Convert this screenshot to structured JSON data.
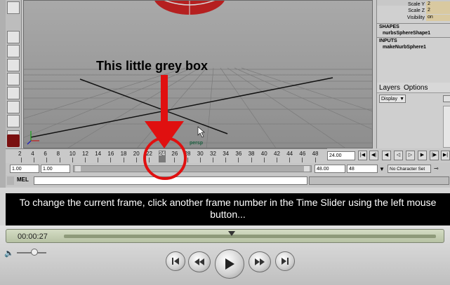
{
  "viewport": {
    "annotation": "This little grey box",
    "camera_label": "persp"
  },
  "attributes": {
    "rows": [
      {
        "label": "Scale Y",
        "value": "2"
      },
      {
        "label": "Scale Z",
        "value": "2"
      },
      {
        "label": "Visibility",
        "value": "on"
      }
    ],
    "shapes_header": "SHAPES",
    "shape_node": "nurbsSphereShape1",
    "inputs_header": "INPUTS",
    "input_node": "makeNurbSphere1"
  },
  "layers": {
    "menu_layers": "Layers",
    "menu_options": "Options",
    "display_select": "Display"
  },
  "time_slider": {
    "ticks": [
      "2",
      "4",
      "6",
      "8",
      "10",
      "12",
      "14",
      "16",
      "18",
      "20",
      "22",
      "24",
      "26",
      "28",
      "30",
      "32",
      "34",
      "36",
      "38",
      "40",
      "42",
      "44",
      "46",
      "48"
    ],
    "current_frame": "24",
    "current_time_field": "24.00"
  },
  "range": {
    "start_time": "1.00",
    "playback_start": "1.00",
    "playback_end": "48.00",
    "end_time": "48",
    "character_set": "No Character Set"
  },
  "command_line": {
    "label": "MEL"
  },
  "caption": "To change the current frame, click another frame number in the Time Slider using the left mouse button...",
  "player": {
    "timecode": "00:00:27",
    "progress": 0.45,
    "volume": 0.6
  },
  "colors": {
    "annotation_red": "#e01010",
    "caption_bg": "#000000",
    "lcd_green": "#c8d1b4"
  }
}
